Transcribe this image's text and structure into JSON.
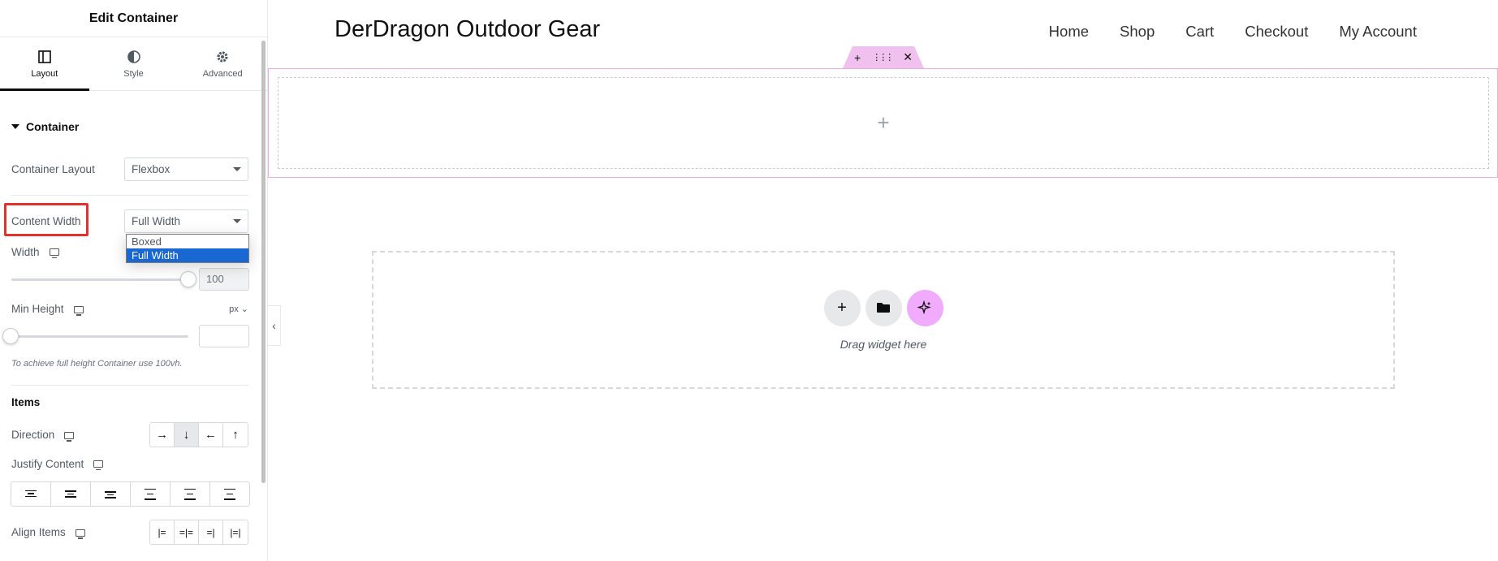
{
  "panel": {
    "title": "Edit Container",
    "tabs": [
      {
        "label": "Layout",
        "icon": "layout-icon",
        "active": true
      },
      {
        "label": "Style",
        "icon": "half-circle-icon",
        "active": false
      },
      {
        "label": "Advanced",
        "icon": "gear-icon",
        "active": false
      }
    ],
    "section_title": "Container",
    "container_layout": {
      "label": "Container Layout",
      "value": "Flexbox"
    },
    "content_width": {
      "label": "Content Width",
      "value": "Full Width",
      "options": [
        "Boxed",
        "Full Width"
      ],
      "selected_option": "Full Width"
    },
    "width": {
      "label": "Width",
      "value": "100",
      "slider_fraction": 1.0
    },
    "min_height": {
      "label": "Min Height",
      "unit": "px",
      "value": "",
      "slider_fraction": 0.0
    },
    "hint": "To achieve full height Container use 100vh.",
    "items_title": "Items",
    "direction": {
      "label": "Direction",
      "options": [
        "→",
        "↓",
        "←",
        "↑"
      ],
      "active_index": 1
    },
    "justify_content": {
      "label": "Justify Content"
    },
    "align_items": {
      "label": "Align Items"
    }
  },
  "site": {
    "title": "DerDragon Outdoor Gear",
    "nav": [
      "Home",
      "Shop",
      "Cart",
      "Checkout",
      "My Account"
    ]
  },
  "canvas": {
    "handle_icons": [
      "+",
      "⋮⋮⋮",
      "✕"
    ],
    "container_add": "+",
    "dropzone_text": "Drag widget here"
  },
  "colors": {
    "accent_pink": "#f0abfc",
    "selection_blue": "#1967d2",
    "highlight_red": "#e5312c"
  }
}
